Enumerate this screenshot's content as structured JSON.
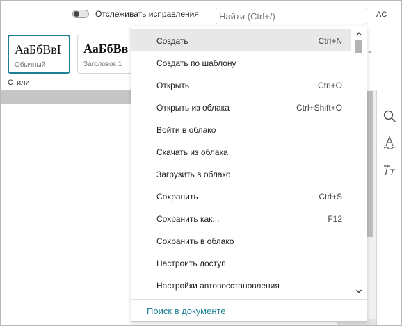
{
  "topbar": {
    "track_changes_label": "Отслеживать исправления",
    "search_placeholder": "Найти (Ctrl+/)",
    "user_initials": "AC"
  },
  "ribbon": {
    "styles": [
      {
        "sample": "АаБбВвI",
        "caption": "Обычный",
        "selected": true
      },
      {
        "sample": "АаБбВв",
        "caption": "Заголовок 1",
        "selected": false
      }
    ],
    "group_label": "Стили",
    "overflow_glyph": "°"
  },
  "menu": {
    "items": [
      {
        "label": "Создать",
        "shortcut": "Ctrl+N",
        "active": true
      },
      {
        "label": "Создать по шаблону",
        "shortcut": ""
      },
      {
        "label": "Открыть",
        "shortcut": "Ctrl+O"
      },
      {
        "label": "Открыть из облака",
        "shortcut": "Ctrl+Shift+O"
      },
      {
        "label": "Войти в облако",
        "shortcut": ""
      },
      {
        "label": "Скачать из облака",
        "shortcut": ""
      },
      {
        "label": "Загрузить в облако",
        "shortcut": ""
      },
      {
        "label": "Сохранить",
        "shortcut": "Ctrl+S"
      },
      {
        "label": "Сохранить как...",
        "shortcut": "F12"
      },
      {
        "label": "Сохранить в облако",
        "shortcut": ""
      },
      {
        "label": "Настроить доступ",
        "shortcut": ""
      },
      {
        "label": "Настройки автовосстановления",
        "shortcut": ""
      }
    ],
    "search_in_document_label": "Поиск в документе"
  },
  "sidebar": {
    "icons": [
      "search-icon",
      "text-style-icon",
      "typography-icon"
    ]
  },
  "colors": {
    "accent": "#1c7f93",
    "menu_highlight": "#e8e8e8",
    "gray_strip": "#c6c6c6"
  }
}
